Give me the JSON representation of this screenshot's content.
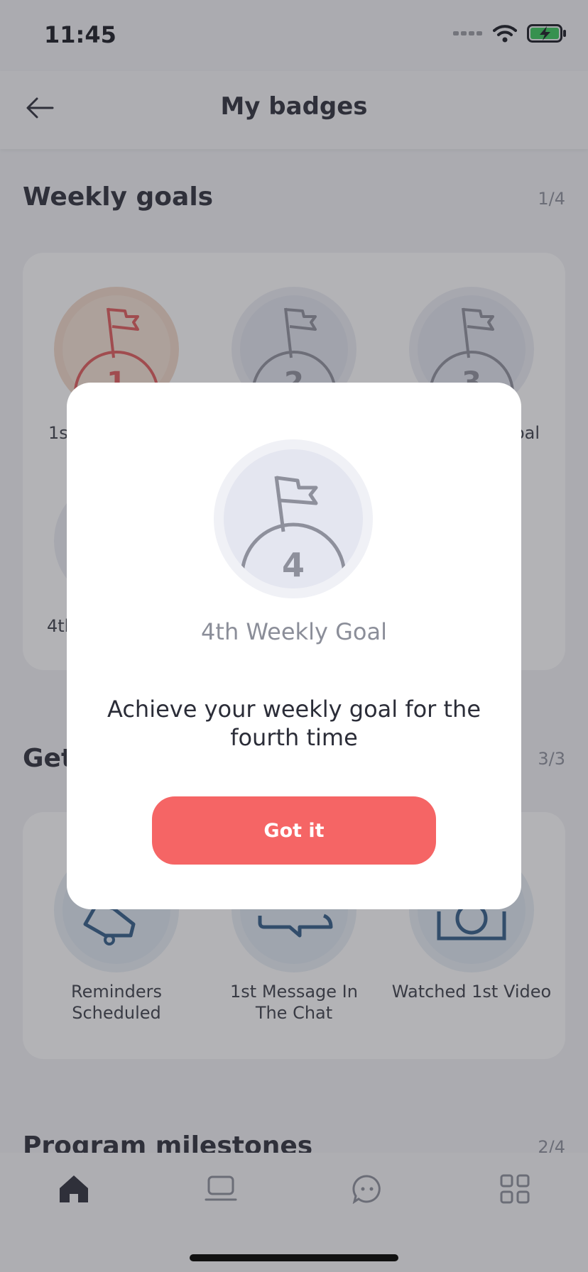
{
  "status": {
    "time": "11:45"
  },
  "header": {
    "title": "My badges"
  },
  "sections": {
    "weekly": {
      "title": "Weekly goals",
      "count": "1/4",
      "badges": [
        {
          "number": "1",
          "label_partial": "1st"
        },
        {
          "number": "2",
          "label_partial": ""
        },
        {
          "number": "3",
          "label_partial": "oal"
        },
        {
          "number": "4",
          "label_partial": "4th"
        }
      ]
    },
    "getting_started": {
      "title_partial": "Get",
      "count": "3/3",
      "badges": [
        {
          "label": "Reminders Scheduled"
        },
        {
          "label": "1st Message In The Chat"
        },
        {
          "label": "Watched 1st Video"
        }
      ]
    },
    "milestones": {
      "title": "Program milestones",
      "count": "2/4"
    }
  },
  "modal": {
    "badge_number": "4",
    "badge_title": "4th Weekly Goal",
    "description": "Achieve your weekly goal for the fourth time",
    "button_label": "Got it"
  },
  "colors": {
    "accent": "#f56565",
    "blue_badge": "#2f5b86",
    "scrim": "rgba(55,56,63,0.38)"
  }
}
